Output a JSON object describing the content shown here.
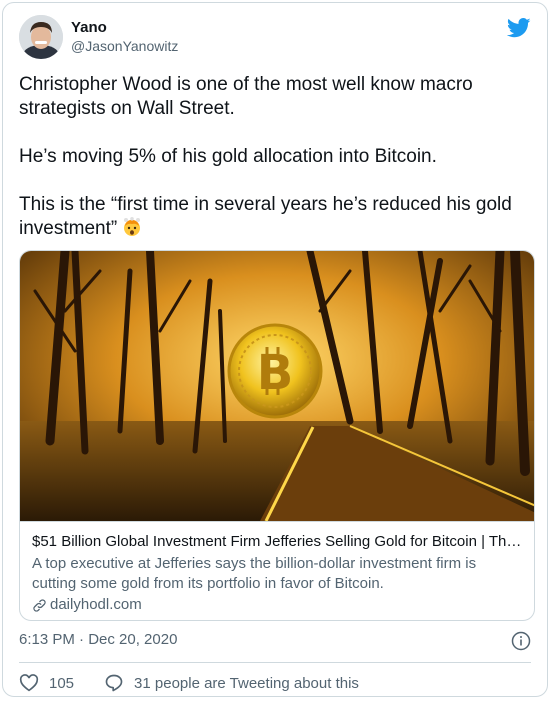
{
  "author": {
    "name": "Yano",
    "handle": "@JasonYanowitz"
  },
  "tweet": {
    "paragraphs": [
      "Christopher Wood is one of the most well know macro strategists on Wall Street.",
      "He’s moving 5% of his gold allocation into Bitcoin.",
      "This is the “first time in several years he’s reduced his gold investment”"
    ],
    "emoji": "exploding-head"
  },
  "card": {
    "title": "$51 Billion Global Investment Firm Jefferies Selling Gold for Bitcoin | Th…",
    "description": "A top executive at Jefferies says the billion-dollar investment firm is cutting some gold from its portfolio in favor of Bitcoin.",
    "domain": "dailyhodl.com"
  },
  "meta": {
    "timestamp": "6:13 PM · Dec 20, 2020"
  },
  "actions": {
    "likes": "105",
    "conversation": "31 people are Tweeting about this"
  },
  "colors": {
    "twitter_blue": "#1d9bf0",
    "secondary_text": "#536471",
    "border": "#cfd9de"
  }
}
